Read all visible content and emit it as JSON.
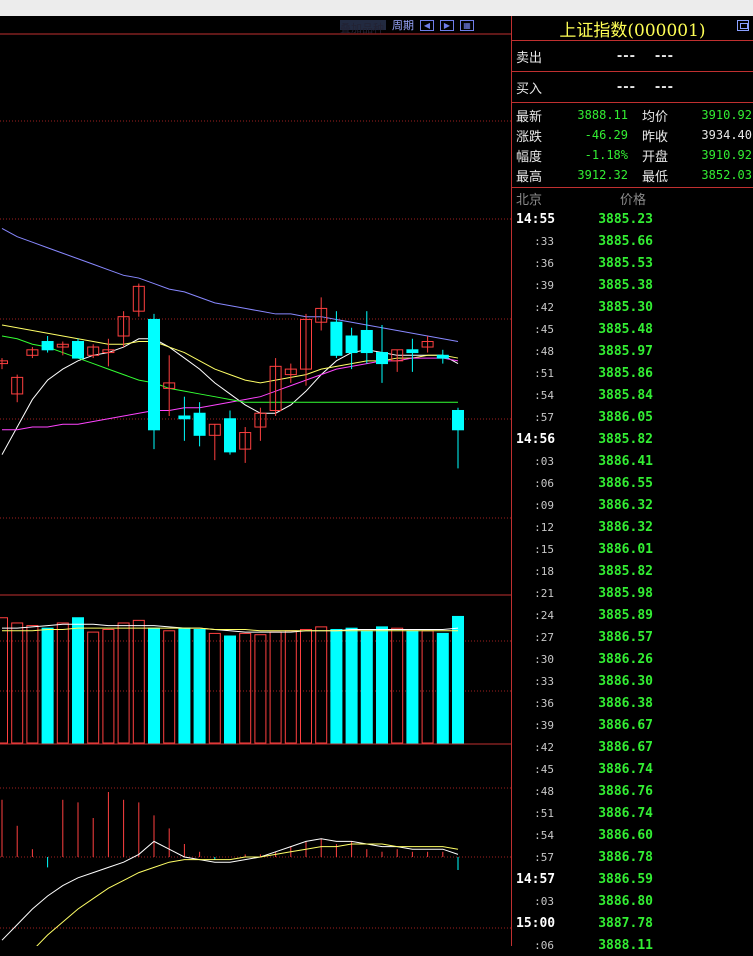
{
  "window": {
    "title": "上证指数(000001)"
  },
  "toolbar": {
    "period_label": "周期",
    "hidden_tab_label": "叠加品种"
  },
  "quote": {
    "sell": {
      "label": "卖出",
      "price": "---",
      "volume": "---"
    },
    "buy": {
      "label": "买入",
      "price": "---",
      "volume": "---"
    },
    "stats": [
      {
        "l1": "最新",
        "v1": "3888.11",
        "c1": "down",
        "l2": "均价",
        "v2": "3910.92",
        "c2": "down"
      },
      {
        "l1": "涨跌",
        "v1": "-46.29",
        "c1": "down",
        "l2": "昨收",
        "v2": "3934.40",
        "c2": "white"
      },
      {
        "l1": "幅度",
        "v1": "-1.18%",
        "c1": "down",
        "l2": "开盘",
        "v2": "3910.92",
        "c2": "down"
      },
      {
        "l1": "最高",
        "v1": "3912.32",
        "c1": "down",
        "l2": "最低",
        "v2": "3852.03",
        "c2": "down"
      }
    ]
  },
  "ticks_header": {
    "time_col": "北京",
    "price_col": "价格"
  },
  "ticks": [
    {
      "time": "14:55",
      "price": "3885.23",
      "major": true
    },
    {
      "time": ":33",
      "price": "3885.66"
    },
    {
      "time": ":36",
      "price": "3885.53"
    },
    {
      "time": ":39",
      "price": "3885.38"
    },
    {
      "time": ":42",
      "price": "3885.30"
    },
    {
      "time": ":45",
      "price": "3885.48"
    },
    {
      "time": ":48",
      "price": "3885.97"
    },
    {
      "time": ":51",
      "price": "3885.86"
    },
    {
      "time": ":54",
      "price": "3885.84"
    },
    {
      "time": ":57",
      "price": "3886.05"
    },
    {
      "time": "14:56",
      "price": "3885.82",
      "major": true
    },
    {
      "time": ":03",
      "price": "3886.41"
    },
    {
      "time": ":06",
      "price": "3886.55"
    },
    {
      "time": ":09",
      "price": "3886.32"
    },
    {
      "time": ":12",
      "price": "3886.32"
    },
    {
      "time": ":15",
      "price": "3886.01"
    },
    {
      "time": ":18",
      "price": "3885.82"
    },
    {
      "time": ":21",
      "price": "3885.98"
    },
    {
      "time": ":24",
      "price": "3885.89"
    },
    {
      "time": ":27",
      "price": "3886.57"
    },
    {
      "time": ":30",
      "price": "3886.26"
    },
    {
      "time": ":33",
      "price": "3886.30"
    },
    {
      "time": ":36",
      "price": "3886.38"
    },
    {
      "time": ":39",
      "price": "3886.67"
    },
    {
      "time": ":42",
      "price": "3886.67"
    },
    {
      "time": ":45",
      "price": "3886.74"
    },
    {
      "time": ":48",
      "price": "3886.76"
    },
    {
      "time": ":51",
      "price": "3886.74"
    },
    {
      "time": ":54",
      "price": "3886.60"
    },
    {
      "time": ":57",
      "price": "3886.78"
    },
    {
      "time": "14:57",
      "price": "3886.59",
      "major": true
    },
    {
      "time": ":03",
      "price": "3886.80"
    },
    {
      "time": "15:00",
      "price": "3887.78",
      "major": true
    },
    {
      "time": ":06",
      "price": "3888.11"
    }
  ],
  "colors": {
    "up": "#ff4040",
    "down": "#00ffff",
    "grid": "#a02020",
    "price_text": "#33ee33",
    "title": "#ffff55"
  },
  "chart_data": {
    "type": "candlestick",
    "ohlc": [
      {
        "o": 3948,
        "h": 3950,
        "l": 3946,
        "c": 3949
      },
      {
        "o": 3937,
        "h": 3944,
        "l": 3934,
        "c": 3943
      },
      {
        "o": 3951,
        "h": 3954,
        "l": 3950,
        "c": 3953
      },
      {
        "o": 3956,
        "h": 3958,
        "l": 3952,
        "c": 3953
      },
      {
        "o": 3954,
        "h": 3956,
        "l": 3951,
        "c": 3955
      },
      {
        "o": 3956,
        "h": 3957,
        "l": 3950,
        "c": 3950
      },
      {
        "o": 3951,
        "h": 3955,
        "l": 3950,
        "c": 3954
      },
      {
        "o": 3952,
        "h": 3957,
        "l": 3947,
        "c": 3953
      },
      {
        "o": 3958,
        "h": 3967,
        "l": 3954,
        "c": 3965
      },
      {
        "o": 3967,
        "h": 3977,
        "l": 3965,
        "c": 3976
      },
      {
        "o": 3964,
        "h": 3966,
        "l": 3917,
        "c": 3924
      },
      {
        "o": 3939,
        "h": 3951,
        "l": 3929,
        "c": 3941
      },
      {
        "o": 3929,
        "h": 3936,
        "l": 3920,
        "c": 3928
      },
      {
        "o": 3930,
        "h": 3934,
        "l": 3918,
        "c": 3922
      },
      {
        "o": 3922,
        "h": 3926,
        "l": 3913,
        "c": 3926
      },
      {
        "o": 3928,
        "h": 3931,
        "l": 3915,
        "c": 3916
      },
      {
        "o": 3917,
        "h": 3925,
        "l": 3912,
        "c": 3923
      },
      {
        "o": 3925,
        "h": 3932,
        "l": 3920,
        "c": 3930
      },
      {
        "o": 3931,
        "h": 3950,
        "l": 3929,
        "c": 3947
      },
      {
        "o": 3944,
        "h": 3948,
        "l": 3941,
        "c": 3946
      },
      {
        "o": 3946,
        "h": 3966,
        "l": 3940,
        "c": 3964
      },
      {
        "o": 3963,
        "h": 3972,
        "l": 3960,
        "c": 3968
      },
      {
        "o": 3963,
        "h": 3967,
        "l": 3950,
        "c": 3951
      },
      {
        "o": 3958,
        "h": 3961,
        "l": 3946,
        "c": 3952
      },
      {
        "o": 3960,
        "h": 3967,
        "l": 3948,
        "c": 3952
      },
      {
        "o": 3952,
        "h": 3962,
        "l": 3941,
        "c": 3948
      },
      {
        "o": 3949,
        "h": 3953,
        "l": 3945,
        "c": 3953
      },
      {
        "o": 3953,
        "h": 3957,
        "l": 3945,
        "c": 3952
      },
      {
        "o": 3954,
        "h": 3958,
        "l": 3952,
        "c": 3956
      },
      {
        "o": 3951,
        "h": 3953,
        "l": 3948,
        "c": 3950
      },
      {
        "o": 3931,
        "h": 3932,
        "l": 3910,
        "c": 3924
      }
    ],
    "ma_lines": [
      {
        "color": "#ffffff",
        "values": [
          3915,
          3925,
          3935,
          3942,
          3946,
          3949,
          3951,
          3952,
          3954,
          3957,
          3957,
          3954,
          3950,
          3946,
          3941,
          3937,
          3933,
          3930,
          3930,
          3933,
          3938,
          3944,
          3949,
          3952,
          3953,
          3952,
          3951,
          3951,
          3951,
          3951,
          3948
        ]
      },
      {
        "color": "#ffff66",
        "values": [
          3962,
          3961,
          3960,
          3959,
          3958,
          3957,
          3956,
          3955,
          3955,
          3956,
          3956,
          3954,
          3952,
          3949,
          3946,
          3944,
          3942,
          3941,
          3942,
          3943,
          3944,
          3946,
          3947,
          3948,
          3949,
          3949,
          3950,
          3950,
          3951,
          3951,
          3950
        ]
      },
      {
        "color": "#ff44ff",
        "values": [
          3924,
          3924,
          3925,
          3925,
          3926,
          3926,
          3927,
          3928,
          3929,
          3930,
          3931,
          3931,
          3932,
          3932,
          3933,
          3934,
          3935,
          3936,
          3938,
          3940,
          3942,
          3944,
          3946,
          3947,
          3948,
          3949,
          3949,
          3950,
          3950,
          3950,
          3949
        ]
      },
      {
        "color": "#33ff33",
        "values": [
          3958,
          3957,
          3955,
          3954,
          3952,
          3950,
          3948,
          3946,
          3944,
          3942,
          3941,
          3939,
          3938,
          3937,
          3936,
          3935,
          3934,
          3934,
          3934,
          3934,
          3934,
          3934,
          3934,
          3934,
          3934,
          3934,
          3934,
          3934,
          3934,
          3934,
          3934
        ]
      },
      {
        "color": "#8888ff",
        "values": [
          3997,
          3994,
          3992,
          3990,
          3988,
          3986,
          3984,
          3982,
          3980,
          3979,
          3977,
          3975,
          3974,
          3972,
          3970,
          3969,
          3968,
          3967,
          3966,
          3966,
          3965,
          3965,
          3964,
          3963,
          3962,
          3961,
          3960,
          3959,
          3958,
          3957,
          3956
        ]
      }
    ],
    "volume": [
      96,
      92,
      90,
      88,
      92,
      96,
      85,
      87,
      92,
      94,
      88,
      86,
      88,
      87,
      84,
      82,
      84,
      83,
      85,
      86,
      87,
      89,
      87,
      88,
      86,
      89,
      88,
      86,
      86,
      84,
      97
    ],
    "volume_ma": [
      {
        "color": "#ffffff",
        "values": [
          88,
          88,
          89,
          90,
          91,
          91,
          91,
          90,
          90,
          90,
          90,
          89,
          88,
          88,
          87,
          86,
          85,
          85,
          85,
          85,
          86,
          86,
          86,
          87,
          87,
          87,
          87,
          87,
          87,
          87,
          88
        ]
      },
      {
        "color": "#ffff66",
        "values": [
          86,
          86,
          86,
          87,
          87,
          88,
          88,
          88,
          88,
          88,
          88,
          88,
          88,
          88,
          87,
          87,
          87,
          86,
          86,
          86,
          86,
          86,
          86,
          86,
          86,
          86,
          86,
          86,
          86,
          86,
          86
        ]
      }
    ],
    "macd_hist": [
      2.2,
      1.2,
      0.3,
      -0.4,
      2.2,
      2.1,
      1.5,
      2.5,
      2.2,
      2.1,
      1.6,
      1.1,
      0.5,
      0.2,
      -0.1,
      0,
      0.1,
      0.1,
      0.2,
      0.4,
      0.6,
      0.7,
      0.5,
      0.6,
      0.3,
      0.2,
      0.3,
      0.2,
      0.2,
      0.2,
      -0.5
    ],
    "macd_lines": [
      {
        "color": "#ffffff",
        "values": [
          -3.2,
          -2.6,
          -2.0,
          -1.5,
          -1.1,
          -0.8,
          -0.6,
          -0.4,
          -0.2,
          0.1,
          0.6,
          0.3,
          0.0,
          -0.1,
          -0.2,
          -0.2,
          -0.1,
          0.0,
          0.2,
          0.4,
          0.6,
          0.7,
          0.6,
          0.6,
          0.5,
          0.4,
          0.4,
          0.3,
          0.3,
          0.3,
          0.1
        ]
      },
      {
        "color": "#ffff66",
        "values": [
          -4.8,
          -4.2,
          -3.6,
          -3.0,
          -2.5,
          -2.0,
          -1.6,
          -1.2,
          -0.9,
          -0.6,
          -0.4,
          -0.2,
          -0.1,
          -0.1,
          -0.1,
          -0.1,
          0.0,
          0.0,
          0.1,
          0.2,
          0.3,
          0.4,
          0.4,
          0.5,
          0.5,
          0.5,
          0.4,
          0.4,
          0.4,
          0.4,
          0.3
        ]
      }
    ]
  }
}
